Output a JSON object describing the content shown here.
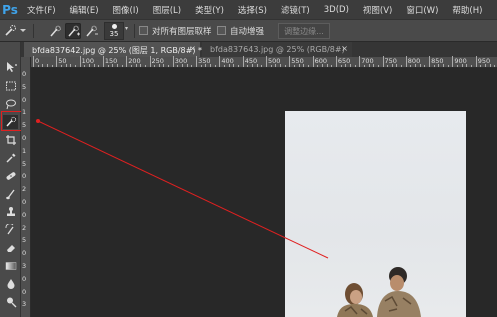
{
  "app": {
    "logo": "Ps"
  },
  "menu": [
    "文件(F)",
    "编辑(E)",
    "图像(I)",
    "图层(L)",
    "类型(Y)",
    "选择(S)",
    "滤镜(T)",
    "3D(D)",
    "视图(V)",
    "窗口(W)",
    "帮助(H)"
  ],
  "options": {
    "brush_size": "35",
    "sample_all_layers": "对所有图层取样",
    "auto_enhance": "自动增强",
    "refine_edge": "调整边缘..."
  },
  "tabs": [
    {
      "label": "bfda837642.jpg @ 25% (图层 1, RGB/8#) *",
      "close": "×"
    },
    {
      "label": "bfda837643.jpg @ 25% (RGB/8#)",
      "close": "×"
    }
  ],
  "ruler": {
    "h_ticks": [
      "0",
      "50",
      "100",
      "150",
      "200",
      "250",
      "300",
      "350",
      "400",
      "450",
      "500",
      "550",
      "600",
      "650",
      "700",
      "750",
      "800",
      "850",
      "900",
      "950"
    ],
    "v_ticks": [
      "0",
      "5",
      "0",
      "1",
      "5",
      "0",
      "1",
      "5",
      "0",
      "2",
      "0",
      "0",
      "2",
      "5",
      "0",
      "3",
      "0",
      "0",
      "3",
      "5"
    ]
  },
  "colors": {
    "annotation": "#e02020",
    "logo": "#3fa3ea",
    "active_tool_bg": "#2e2e2e"
  }
}
